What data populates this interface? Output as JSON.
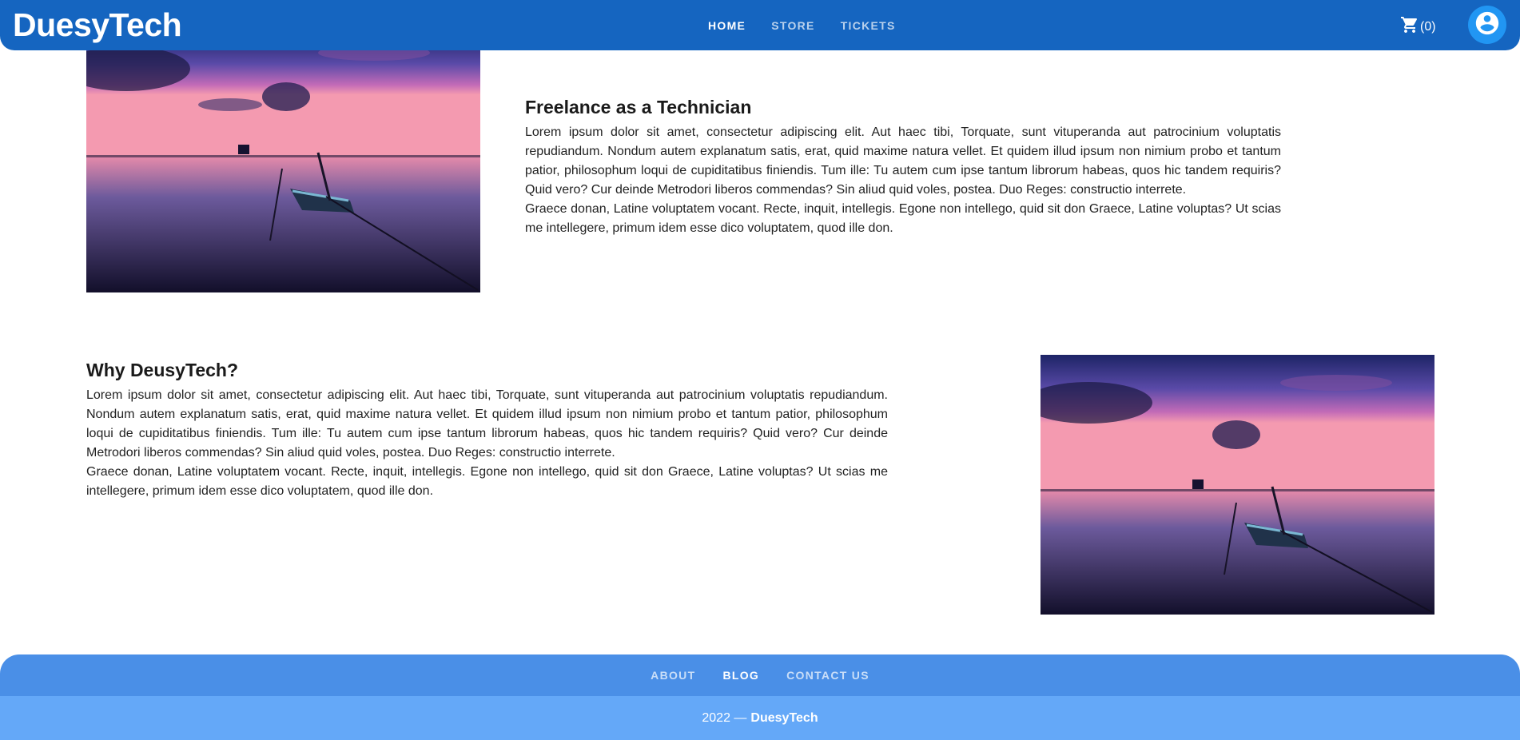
{
  "header": {
    "brand": "DuesyTech",
    "nav": [
      {
        "label": "HOME",
        "active": true
      },
      {
        "label": "STORE",
        "active": false
      },
      {
        "label": "TICKETS",
        "active": false
      }
    ],
    "cart_count": "(0)",
    "cart_icon": "cart-icon",
    "account_icon": "account-circle-icon"
  },
  "sections": [
    {
      "title": "Freelance as a Technician",
      "paragraphs": [
        "Lorem ipsum dolor sit amet, consectetur adipiscing elit. Aut haec tibi, Torquate, sunt vituperanda aut patrocinium voluptatis repudiandum. Nondum autem explanatum satis, erat, quid maxime natura vellet. Et quidem illud ipsum non nimium probo et tantum patior, philosophum loqui de cupiditatibus finiendis. Tum ille: Tu autem cum ipse tantum librorum habeas, quos hic tandem requiris? Quid vero? Cur deinde Metrodori liberos commendas? Sin aliud quid voles, postea. Duo Reges: constructio interrete.",
        "Graece donan, Latine voluptatem vocant. Recte, inquit, intellegis. Egone non intellego, quid sit don Graece, Latine voluptas? Ut scias me intellegere, primum idem esse dico voluptatem, quod ille don."
      ]
    },
    {
      "title": "Why DeusyTech?",
      "paragraphs": [
        "Lorem ipsum dolor sit amet, consectetur adipiscing elit. Aut haec tibi, Torquate, sunt vituperanda aut patrocinium voluptatis repudiandum. Nondum autem explanatum satis, erat, quid maxime natura vellet. Et quidem illud ipsum non nimium probo et tantum patior, philosophum loqui de cupiditatibus finiendis. Tum ille: Tu autem cum ipse tantum librorum habeas, quos hic tandem requiris? Quid vero? Cur deinde Metrodori liberos commendas? Sin aliud quid voles, postea. Duo Reges: constructio interrete.",
        "Graece donan, Latine voluptatem vocant. Recte, inquit, intellegis. Egone non intellego, quid sit don Graece, Latine voluptas? Ut scias me intellegere, primum idem esse dico voluptatem, quod ille don."
      ]
    }
  ],
  "footer": {
    "links": [
      {
        "label": "ABOUT",
        "active": false
      },
      {
        "label": "BLOG",
        "active": true
      },
      {
        "label": "CONTACT US",
        "active": false
      }
    ],
    "year_text": "2022 —",
    "brand": "DuesyTech"
  },
  "colors": {
    "header_bg": "#1565c0",
    "avatar_bg": "#2196f3",
    "footer_nav_bg": "#4a8fe7",
    "footer_bar_bg": "#64a8f8"
  }
}
